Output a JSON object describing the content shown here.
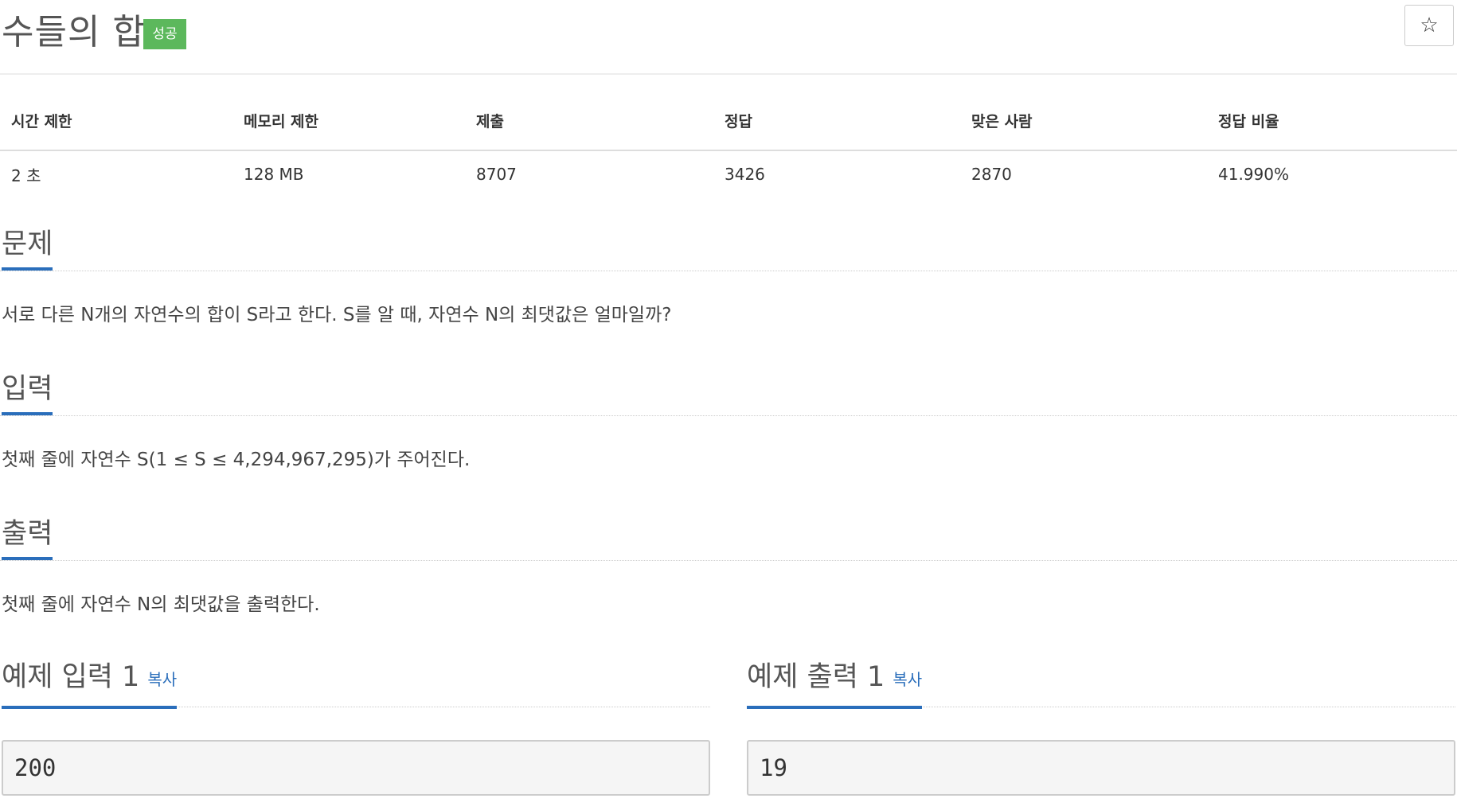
{
  "problem": {
    "title": "수들의 합",
    "status_badge": "성공",
    "star_icon": "☆"
  },
  "stats": {
    "headers": [
      "시간 제한",
      "메모리 제한",
      "제출",
      "정답",
      "맞은 사람",
      "정답 비율"
    ],
    "values": [
      "2 초",
      "128 MB",
      "8707",
      "3426",
      "2870",
      "41.990%"
    ]
  },
  "sections": {
    "problem": {
      "title": "문제",
      "text": "서로 다른 N개의 자연수의 합이 S라고 한다. S를 알 때, 자연수 N의 최댓값은 얼마일까?"
    },
    "input": {
      "title": "입력",
      "text": "첫째 줄에 자연수 S(1 ≤ S ≤ 4,294,967,295)가 주어진다."
    },
    "output": {
      "title": "출력",
      "text": "첫째 줄에 자연수 N의 최댓값을 출력한다."
    }
  },
  "examples": {
    "input": {
      "title": "예제 입력 1",
      "copy_label": "복사",
      "value": "200"
    },
    "output": {
      "title": "예제 출력 1",
      "copy_label": "복사",
      "value": "19"
    }
  },
  "colors": {
    "accent": "#2a6ebb",
    "success_badge": "#5cb85c"
  }
}
